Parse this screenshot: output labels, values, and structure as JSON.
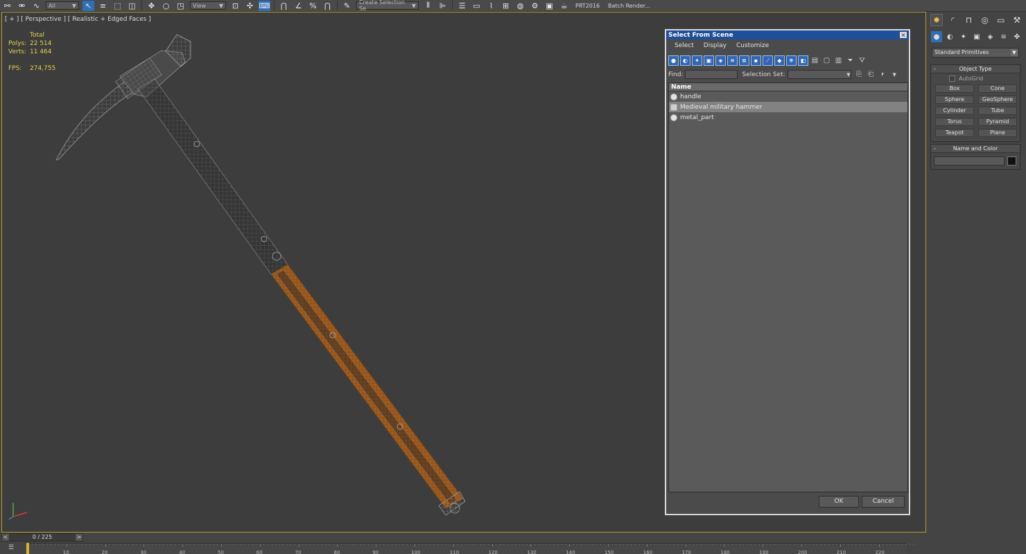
{
  "toolbar": {
    "filter_value": "All",
    "view_value": "View",
    "named_selection_placeholder": "Create Selection Se",
    "right_items": [
      "PRT2016",
      "Batch Render..."
    ]
  },
  "viewport": {
    "label": "[ + ] [ Perspective ] [ Realistic + Edged Faces ]",
    "stats": {
      "total_label": "Total",
      "polys_label": "Polys:",
      "polys_value": "22 514",
      "verts_label": "Verts:",
      "verts_value": "11 464",
      "fps_label": "FPS:",
      "fps_value": "274,755"
    }
  },
  "dialog": {
    "title": "Select From Scene",
    "close_glyph": "×",
    "menu": [
      "Select",
      "Display",
      "Customize"
    ],
    "find_label": "Find:",
    "find_value": "",
    "selection_set_label": "Selection Set:",
    "list_header": "Name",
    "items": [
      {
        "name": "handle",
        "icon": "geometry-icon",
        "selected": false
      },
      {
        "name": "Medieval military hammer",
        "icon": "group-icon",
        "selected": true
      },
      {
        "name": "metal_part",
        "icon": "geometry-icon",
        "selected": false
      }
    ],
    "ok_label": "OK",
    "cancel_label": "Cancel"
  },
  "command_panel": {
    "category": "Standard Primitives",
    "object_type_title": "Object Type",
    "autogrid_label": "AutoGrid",
    "primitives": [
      "Box",
      "Cone",
      "Sphere",
      "GeoSphere",
      "Cylinder",
      "Tube",
      "Torus",
      "Pyramid",
      "Teapot",
      "Plane"
    ],
    "name_color_title": "Name and Color",
    "name_value": "",
    "color": "#111111"
  },
  "timeline": {
    "frame_display": "0 / 225",
    "ticks": [
      "10",
      "20",
      "30",
      "40",
      "50",
      "60",
      "70",
      "80",
      "90",
      "100",
      "110",
      "120",
      "130",
      "140",
      "150",
      "160",
      "170",
      "180",
      "190",
      "200",
      "210",
      "220"
    ]
  },
  "colors": {
    "accent": "#2f6fb6",
    "viewport_border": "#b79b2c",
    "stats_text": "#e3d24a",
    "dialog_title": "#1e4f9a",
    "wood": "#b86a22"
  }
}
